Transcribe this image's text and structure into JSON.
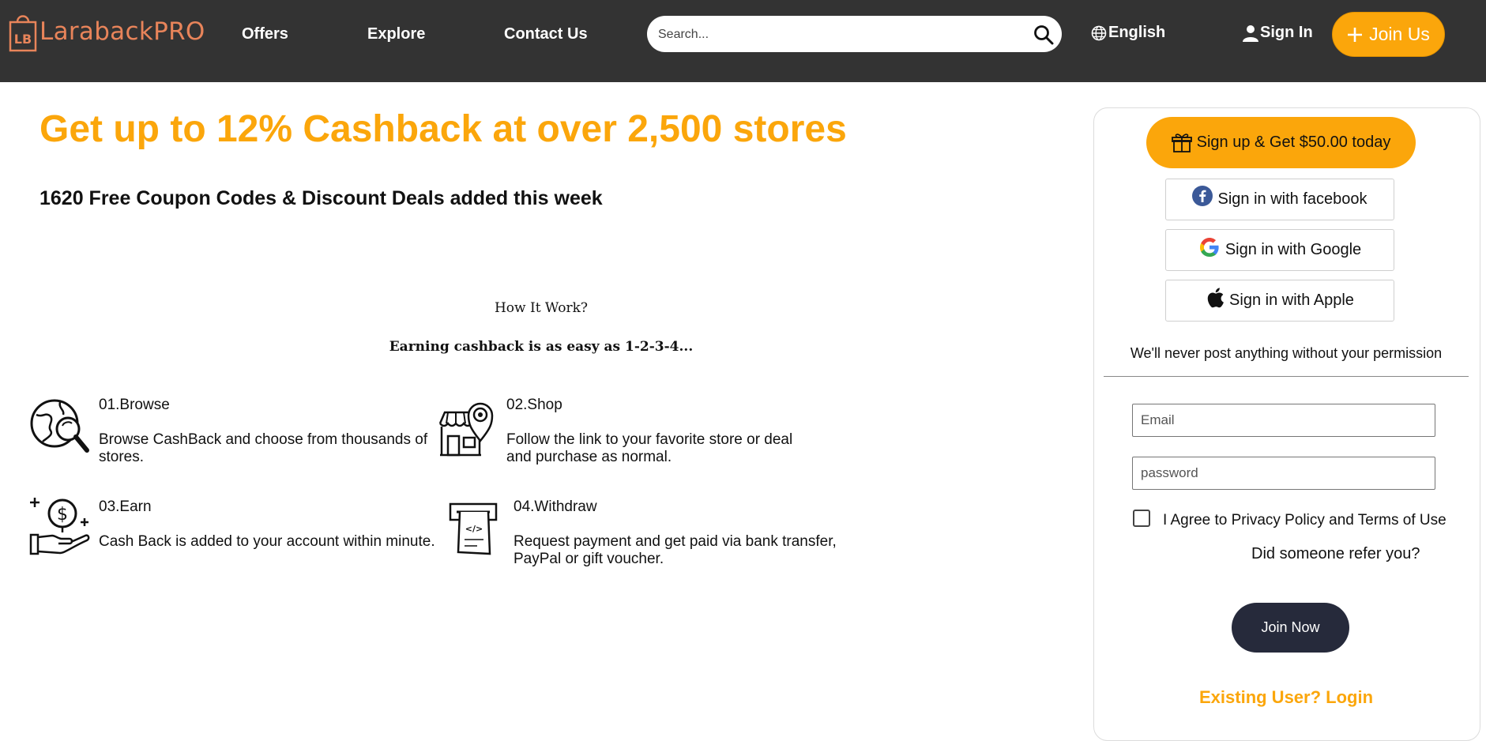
{
  "header": {
    "logo_text": "LarabackPRO",
    "logo_badge": "LB",
    "nav": [
      {
        "label": "Offers"
      },
      {
        "label": "Explore"
      },
      {
        "label": "Contact Us"
      }
    ],
    "search_placeholder": "Search...",
    "language": "English",
    "sign_in": "Sign In",
    "join_us": "Join Us"
  },
  "hero": {
    "headline": "Get up to 12% Cashback at over 2,500 stores",
    "subheadline": "1620 Free Coupon Codes & Discount Deals added this week"
  },
  "how_it_works": {
    "title": "How It Work?",
    "subtitle": "Earning cashback is as easy as 1-2-3-4...",
    "steps": [
      {
        "title": "01.Browse",
        "desc": "Browse CashBack and choose from thousands of stores.",
        "icon": "globe-search-icon"
      },
      {
        "title": "02.Shop",
        "desc": "Follow the link to your favorite store or deal and purchase as normal.",
        "icon": "store-location-icon"
      },
      {
        "title": "03.Earn",
        "desc": "Cash Back is added to your account within minute.",
        "icon": "hand-coin-icon"
      },
      {
        "title": "04.Withdraw",
        "desc": "Request payment and get paid via bank transfer, PayPal or gift voucher.",
        "icon": "cash-withdraw-icon"
      }
    ]
  },
  "signup_panel": {
    "promo_button": "Sign up & Get $50.00 today",
    "facebook": "Sign in with facebook",
    "google": "Sign in with Google",
    "apple": "Sign in with Apple",
    "permission_note": "We'll never post anything without your permission",
    "email_placeholder": "Email",
    "password_placeholder": "password",
    "agree_label": "I Agree to Privacy Policy and Terms of Use",
    "agree_checked": false,
    "refer_text": "Did someone refer you?",
    "join_now": "Join Now",
    "existing_login": "Existing User? Login"
  },
  "colors": {
    "accent": "#fba60b",
    "topbar": "#333333",
    "logo": "#e8845a",
    "join_now_bg": "#262a3b",
    "facebook_blue": "#3b5998"
  }
}
